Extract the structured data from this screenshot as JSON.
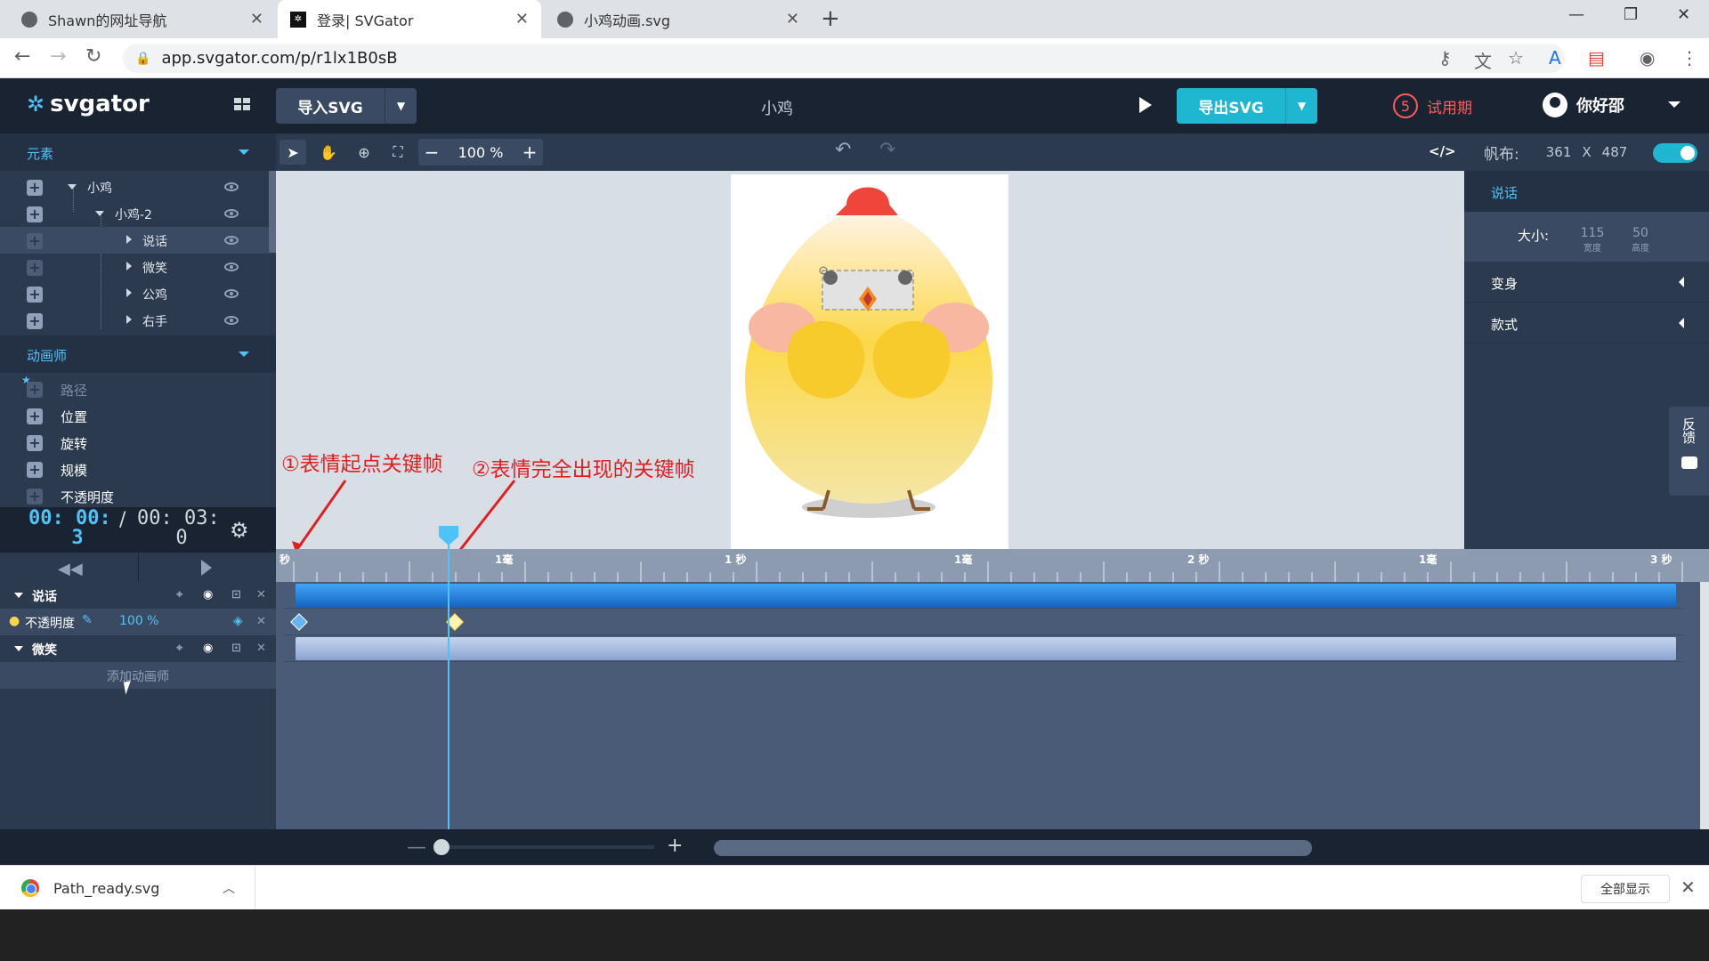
{
  "browser": {
    "tabs": [
      {
        "title": "Shawn的网址导航",
        "active": false
      },
      {
        "title": "登录| SVGator",
        "active": true
      },
      {
        "title": "小鸡动画.svg",
        "active": false
      }
    ],
    "url": "app.svgator.com/p/r1lx1B0sB"
  },
  "header": {
    "logo": "svgator",
    "import_label": "导入SVG",
    "project_title": "小鸡",
    "export_label": "导出SVG",
    "trial_days": "5",
    "trial_label": "试用期",
    "user_name": "你好邵"
  },
  "elements_panel": {
    "title": "元素",
    "items": [
      {
        "label": "小鸡"
      },
      {
        "label": "小鸡-2"
      },
      {
        "label": "说话"
      },
      {
        "label": "微笑"
      },
      {
        "label": "公鸡"
      },
      {
        "label": "右手"
      }
    ]
  },
  "animators_panel": {
    "title": "动画师",
    "items": [
      {
        "label": "路径"
      },
      {
        "label": "位置"
      },
      {
        "label": "旋转"
      },
      {
        "label": "规模"
      },
      {
        "label": "不透明度"
      }
    ]
  },
  "time": {
    "current_line1": "00: 00:",
    "current_line2": "3",
    "separator": "/",
    "total_line1": "00: 03:",
    "total_line2": "0"
  },
  "toolbar": {
    "zoom_minus": "−",
    "zoom_value": "100 %",
    "zoom_plus": "+",
    "code_label": "</>"
  },
  "canvas_props": {
    "label": "帆布:",
    "width": "361",
    "x": "X",
    "height": "487"
  },
  "right_panel": {
    "selected_name": "说话",
    "size_label": "大小:",
    "width_value": "115",
    "width_caption": "宽度",
    "height_value": "50",
    "height_caption": "高度",
    "transform_label": "变身",
    "style_label": "款式",
    "feedback_label": "反馈"
  },
  "annotations": {
    "first": "①表情起点关键帧",
    "second": "②表情完全出现的关键帧"
  },
  "ruler": {
    "labels": [
      "秒",
      "1毫",
      "1 秒",
      "1毫",
      "2 秒",
      "1毫",
      "3 秒"
    ]
  },
  "timeline": {
    "layers": [
      {
        "label": "说话"
      },
      {
        "label": "微笑"
      }
    ],
    "opacity_label": "不透明度",
    "opacity_value": "100 %",
    "add_animator": "添加动画师",
    "playhead_fraction": 0.07
  },
  "download": {
    "filename": "Path_ready.svg",
    "show_all": "全部显示"
  },
  "colors": {
    "accent": "#4fc3f7",
    "export": "#1eb6d0",
    "trial": "#ff5a5a",
    "bar_blue": "#1e88e5",
    "bar_light": "#a9bde0"
  }
}
